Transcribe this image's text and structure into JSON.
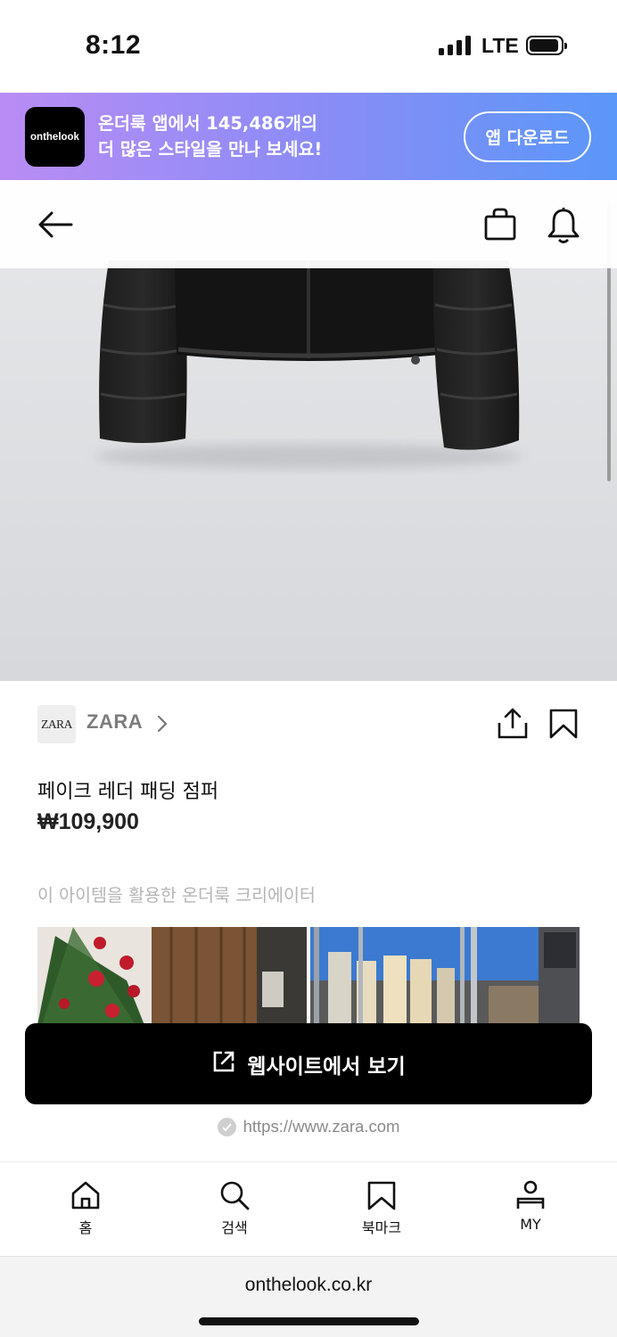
{
  "status_bar": {
    "time": "8:12",
    "network": "LTE",
    "battery_level": 0.95
  },
  "banner": {
    "logo_text": "onthelook",
    "line1": "온더룩 앱에서 145,486개의",
    "line2": "더 많은 스타일을 만나 보세요!",
    "button_label": "앱 다운로드"
  },
  "nav": {
    "back_icon": "arrow-left-icon",
    "bag_icon": "shopping-bag-icon",
    "bell_icon": "bell-icon"
  },
  "product": {
    "brand_logo_text": "ZARA",
    "brand_name": "ZARA",
    "name": "페이크 레더 패딩 점퍼",
    "price": "₩109,900"
  },
  "section": {
    "title": "이 아이템을 활용한 온더룩 크리에이터"
  },
  "cta": {
    "label": "웹사이트에서 보기",
    "icon": "external-link-icon"
  },
  "site": {
    "url": "https://www.zara.com"
  },
  "tabs": [
    {
      "label": "홈",
      "icon": "home-icon"
    },
    {
      "label": "검색",
      "icon": "search-icon"
    },
    {
      "label": "북마크",
      "icon": "bookmark-icon"
    },
    {
      "label": "MY",
      "icon": "user-icon"
    }
  ],
  "browser": {
    "url": "onthelook.co.kr"
  }
}
